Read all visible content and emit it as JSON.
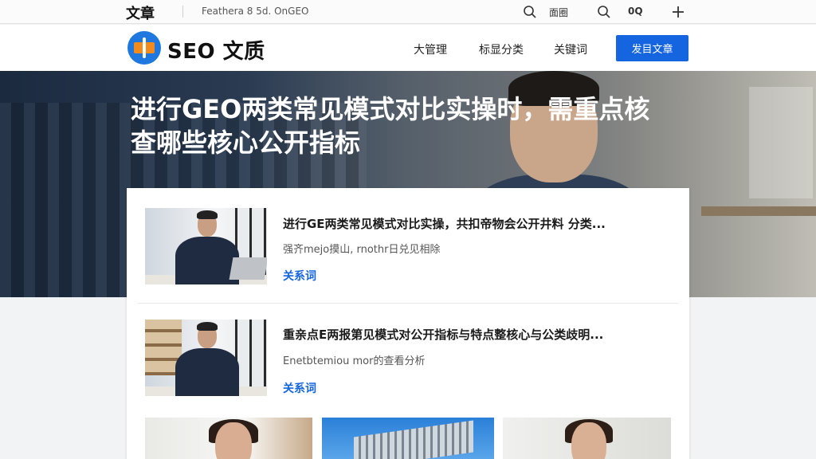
{
  "topbar": {
    "title": "文章",
    "url": "Feathera 8 5d. OnGEO",
    "icon_label": "面圈",
    "search_label": "0Q",
    "icons": [
      "search-icon",
      "search-icon",
      "plus-icon"
    ]
  },
  "header": {
    "brand": "SEO 文质",
    "nav": [
      "大管理",
      "标显分类",
      "关键词"
    ],
    "cta": "发目文章"
  },
  "hero": {
    "title": "进行GEO两类常见模式对比实操时，需重点核查哪些核心公开指标"
  },
  "articles": [
    {
      "title": "进行GE两类常见模式对比实操，共扣帝物会公开井料 分类...",
      "subtitle": "强齐mejo摸山, rnothr日兑见相除",
      "tag": "关系词"
    },
    {
      "title": "重亲点E两报第见模式对公开指标与特点整核心与公类歧明...",
      "subtitle": "Enetbtemiou mor的查看分析",
      "tag": "关系词"
    }
  ],
  "colors": {
    "accent": "#1565e0",
    "logo_blue": "#1e78e0",
    "logo_orange": "#f28a1e"
  }
}
